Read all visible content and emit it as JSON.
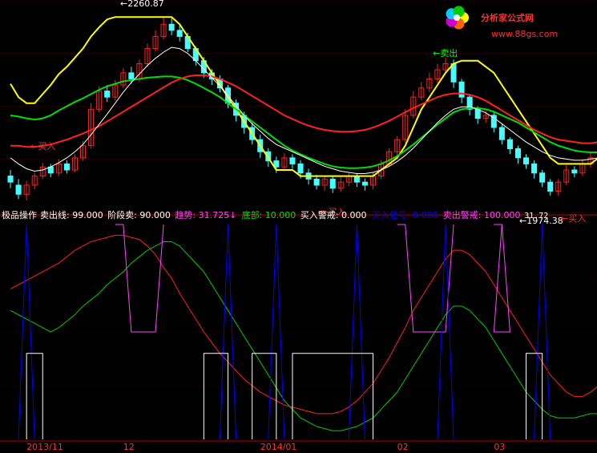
{
  "watermark": {
    "site": "分析家公式网",
    "url": "www.88gs.com"
  },
  "chart_data": {
    "type": "candlestick-indicator",
    "price_panel": {
      "annotations": [
        {
          "text": "2260.87",
          "kind": "high"
        },
        {
          "text": "1974.38",
          "kind": "low"
        },
        {
          "text": "卖出",
          "kind": "sell"
        },
        {
          "text": "买入",
          "kind": "buy"
        },
        {
          "text": "买入",
          "kind": "buy"
        },
        {
          "text": "买入",
          "kind": "buy"
        }
      ],
      "ylim": [
        1940,
        2290
      ],
      "candles": [
        [
          2000,
          1990,
          2010,
          1980
        ],
        [
          1985,
          1970,
          1995,
          1962
        ],
        [
          1970,
          1985,
          1992,
          1960
        ],
        [
          1985,
          2000,
          2006,
          1978
        ],
        [
          2000,
          2015,
          2022,
          1995
        ],
        [
          2015,
          2005,
          2020,
          1998
        ],
        [
          2005,
          2020,
          2028,
          2000
        ],
        [
          2020,
          2010,
          2026,
          2004
        ],
        [
          2010,
          2030,
          2036,
          2006
        ],
        [
          2030,
          2050,
          2058,
          2025
        ],
        [
          2050,
          2110,
          2120,
          2045
        ],
        [
          2110,
          2140,
          2148,
          2105
        ],
        [
          2140,
          2130,
          2150,
          2122
        ],
        [
          2130,
          2150,
          2158,
          2124
        ],
        [
          2150,
          2170,
          2178,
          2145
        ],
        [
          2170,
          2160,
          2180,
          2152
        ],
        [
          2160,
          2185,
          2192,
          2155
        ],
        [
          2185,
          2210,
          2218,
          2180
        ],
        [
          2210,
          2230,
          2240,
          2205
        ],
        [
          2230,
          2250,
          2262,
          2225
        ],
        [
          2250,
          2240,
          2260,
          2232
        ],
        [
          2240,
          2230,
          2248,
          2222
        ],
        [
          2230,
          2210,
          2236,
          2204
        ],
        [
          2210,
          2190,
          2214,
          2182
        ],
        [
          2190,
          2170,
          2196,
          2162
        ],
        [
          2170,
          2160,
          2176,
          2150
        ],
        [
          2160,
          2145,
          2166,
          2138
        ],
        [
          2145,
          2120,
          2150,
          2112
        ],
        [
          2120,
          2100,
          2126,
          2090
        ],
        [
          2100,
          2080,
          2106,
          2070
        ],
        [
          2080,
          2060,
          2088,
          2052
        ],
        [
          2060,
          2040,
          2068,
          2030
        ],
        [
          2040,
          2025,
          2046,
          2015
        ],
        [
          2025,
          2015,
          2032,
          2005
        ],
        [
          2015,
          2030,
          2038,
          2008
        ],
        [
          2030,
          2020,
          2036,
          2012
        ],
        [
          2020,
          2005,
          2026,
          1996
        ],
        [
          2005,
          1995,
          2012,
          1986
        ],
        [
          1995,
          1985,
          2002,
          1978
        ],
        [
          1985,
          1995,
          2000,
          1976
        ],
        [
          1995,
          1980,
          2000,
          1972
        ],
        [
          1980,
          1990,
          1998,
          1974
        ],
        [
          1990,
          2000,
          2006,
          1983
        ],
        [
          2000,
          1990,
          2004,
          1982
        ],
        [
          1990,
          1985,
          1996,
          1976
        ],
        [
          1985,
          2000,
          2006,
          1978
        ],
        [
          2000,
          2020,
          2026,
          1995
        ],
        [
          2020,
          2040,
          2046,
          2015
        ],
        [
          2040,
          2060,
          2066,
          2034
        ],
        [
          2060,
          2100,
          2110,
          2055
        ],
        [
          2100,
          2130,
          2140,
          2095
        ],
        [
          2130,
          2145,
          2155,
          2125
        ],
        [
          2145,
          2160,
          2170,
          2138
        ],
        [
          2160,
          2175,
          2185,
          2154
        ],
        [
          2175,
          2185,
          2195,
          2170
        ],
        [
          2185,
          2155,
          2192,
          2145
        ],
        [
          2155,
          2130,
          2160,
          2120
        ],
        [
          2130,
          2110,
          2135,
          2100
        ],
        [
          2110,
          2095,
          2115,
          2086
        ],
        [
          2095,
          2100,
          2108,
          2088
        ],
        [
          2100,
          2080,
          2105,
          2072
        ],
        [
          2080,
          2060,
          2085,
          2052
        ],
        [
          2060,
          2045,
          2064,
          2036
        ],
        [
          2045,
          2030,
          2050,
          2020
        ],
        [
          2030,
          2020,
          2036,
          2012
        ],
        [
          2020,
          2005,
          2026,
          1996
        ],
        [
          2005,
          1990,
          2010,
          1982
        ],
        [
          1990,
          1975,
          1995,
          1968
        ],
        [
          1975,
          1990,
          1995,
          1968
        ],
        [
          1990,
          2010,
          2018,
          1985
        ],
        [
          2010,
          2005,
          2016,
          1998
        ],
        [
          2005,
          2020,
          2028,
          2000
        ],
        [
          2020,
          2030,
          2038,
          2014
        ]
      ],
      "lines": [
        {
          "name": "yellow",
          "color": "#ffff00",
          "values": [
            2152,
            2130,
            2120,
            2120,
            2135,
            2150,
            2168,
            2180,
            2195,
            2210,
            2230,
            2245,
            2258,
            2262,
            2262,
            2262,
            2262,
            2262,
            2262,
            2262,
            2262,
            2250,
            2230,
            2210,
            2190,
            2170,
            2150,
            2130,
            2110,
            2090,
            2070,
            2050,
            2030,
            2010,
            2010,
            2010,
            2000,
            2000,
            2000,
            2000,
            2000,
            2000,
            2000,
            2000,
            2000,
            2000,
            2010,
            2020,
            2030,
            2050,
            2080,
            2110,
            2130,
            2150,
            2170,
            2185,
            2190,
            2190,
            2190,
            2180,
            2170,
            2150,
            2130,
            2110,
            2090,
            2070,
            2050,
            2030,
            2020,
            2020,
            2020,
            2020,
            2020,
            2030
          ]
        },
        {
          "name": "green",
          "color": "#00dd00",
          "values": [
            2100,
            2098,
            2095,
            2093,
            2095,
            2100,
            2108,
            2115,
            2122,
            2128,
            2135,
            2142,
            2148,
            2152,
            2156,
            2158,
            2160,
            2162,
            2163,
            2164,
            2164,
            2162,
            2158,
            2152,
            2145,
            2138,
            2130,
            2120,
            2110,
            2100,
            2090,
            2080,
            2070,
            2060,
            2050,
            2042,
            2036,
            2030,
            2025,
            2020,
            2016,
            2014,
            2013,
            2013,
            2014,
            2016,
            2020,
            2026,
            2033,
            2042,
            2052,
            2063,
            2074,
            2085,
            2095,
            2105,
            2110,
            2112,
            2112,
            2110,
            2106,
            2100,
            2094,
            2088,
            2080,
            2072,
            2064,
            2056,
            2050,
            2046,
            2042,
            2040,
            2039,
            2039
          ]
        },
        {
          "name": "red",
          "color": "#ff2020",
          "values": [
            2050,
            2050,
            2048,
            2048,
            2050,
            2052,
            2056,
            2060,
            2065,
            2070,
            2076,
            2082,
            2090,
            2098,
            2106,
            2114,
            2122,
            2130,
            2138,
            2146,
            2154,
            2160,
            2164,
            2166,
            2166,
            2164,
            2160,
            2154,
            2148,
            2140,
            2132,
            2124,
            2116,
            2108,
            2100,
            2094,
            2088,
            2083,
            2079,
            2076,
            2074,
            2073,
            2073,
            2074,
            2076,
            2080,
            2085,
            2091,
            2098,
            2105,
            2112,
            2118,
            2124,
            2130,
            2134,
            2136,
            2136,
            2134,
            2130,
            2124,
            2116,
            2108,
            2100,
            2092,
            2084,
            2076,
            2070,
            2064,
            2060,
            2058,
            2056,
            2054,
            2054,
            2056
          ]
        },
        {
          "name": "white",
          "color": "#ffffff",
          "values": [
            2030,
            2020,
            2012,
            2008,
            2010,
            2015,
            2022,
            2030,
            2040,
            2052,
            2068,
            2085,
            2102,
            2120,
            2138,
            2154,
            2168,
            2182,
            2194,
            2204,
            2212,
            2210,
            2202,
            2190,
            2176,
            2162,
            2148,
            2132,
            2116,
            2100,
            2086,
            2074,
            2062,
            2052,
            2046,
            2040,
            2034,
            2028,
            2022,
            2016,
            2012,
            2008,
            2006,
            2004,
            2004,
            2006,
            2010,
            2016,
            2024,
            2034,
            2046,
            2060,
            2074,
            2088,
            2100,
            2110,
            2114,
            2114,
            2110,
            2104,
            2096,
            2086,
            2076,
            2066,
            2056,
            2048,
            2040,
            2034,
            2030,
            2028,
            2026,
            2026,
            2028,
            2030
          ]
        }
      ]
    },
    "indicator_panel": {
      "title": "极品操作",
      "legend": [
        {
          "label": "卖出线",
          "value": "99.000",
          "color": "#ffffff"
        },
        {
          "label": "阶段卖",
          "value": "90.000",
          "color": "#ffffff"
        },
        {
          "label": "趋势",
          "value": "31.725",
          "color": "#ff44ff",
          "suffix": "↓"
        },
        {
          "label": "底部",
          "value": "10.000",
          "color": "#00dd00"
        },
        {
          "label": "买入警戒",
          "value": "0.000",
          "color": "#ffffff"
        },
        {
          "label": "买入信号",
          "value": "0.000",
          "color": "#0000ff"
        },
        {
          "label": "卖出警戒",
          "value": "100.000",
          "color": "#ff44ff"
        },
        {
          "extra": "31.72"
        }
      ],
      "ylim": [
        0,
        100
      ],
      "x_labels": [
        "2013/11",
        "12",
        "2014/01",
        "02",
        "03"
      ]
    }
  }
}
